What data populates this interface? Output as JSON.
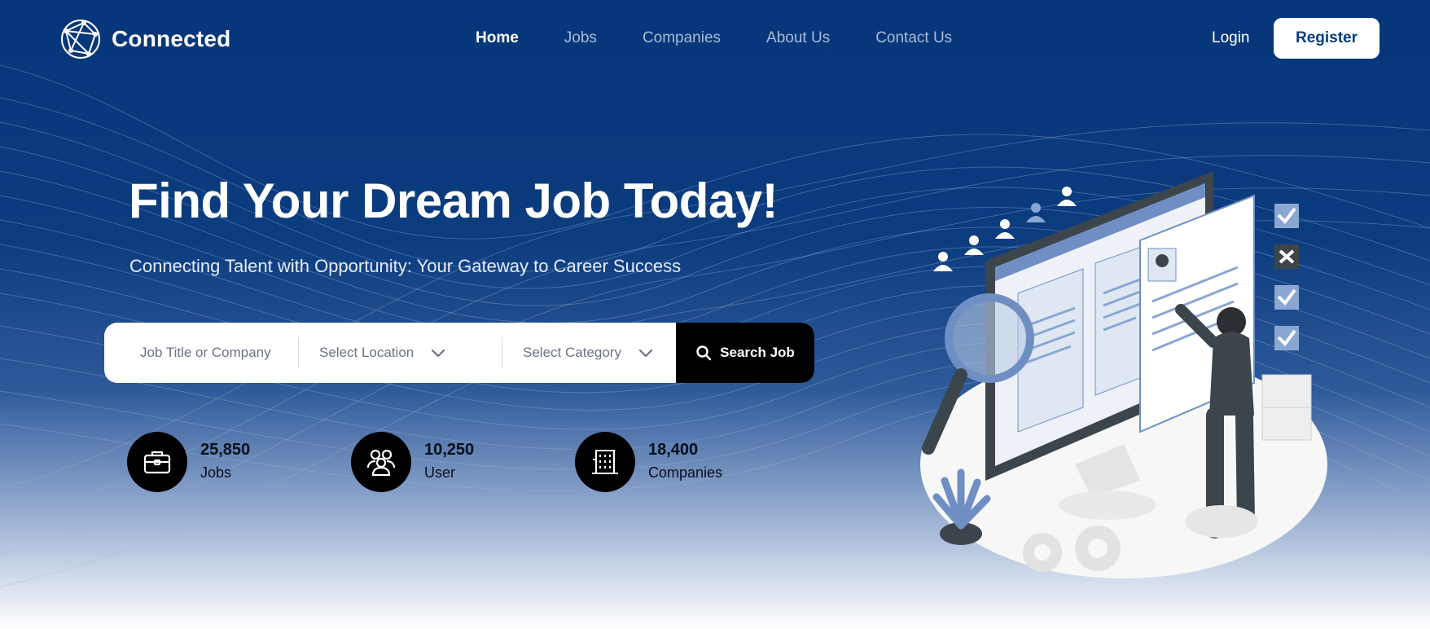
{
  "brand": {
    "name": "Connected"
  },
  "nav": {
    "items": [
      {
        "label": "Home",
        "active": true
      },
      {
        "label": "Jobs",
        "active": false
      },
      {
        "label": "Companies",
        "active": false
      },
      {
        "label": "About Us",
        "active": false
      },
      {
        "label": "Contact Us",
        "active": false
      }
    ],
    "login_label": "Login",
    "register_label": "Register"
  },
  "hero": {
    "title": "Find Your Dream Job Today!",
    "subtitle": "Connecting Talent with Opportunity: Your Gateway to Career Success"
  },
  "search": {
    "keyword_placeholder": "Job Title or Company",
    "location_placeholder": "Select Location",
    "category_placeholder": "Select Category",
    "button_label": "Search Job"
  },
  "stats": [
    {
      "value": "25,850",
      "label": "Jobs",
      "icon": "briefcase-icon"
    },
    {
      "value": "10,250",
      "label": "User",
      "icon": "users-icon"
    },
    {
      "value": "18,400",
      "label": "Companies",
      "icon": "building-icon"
    }
  ],
  "colors": {
    "primary": "#06367a",
    "accent_button": "#000000",
    "register_text": "#0b3c7e",
    "illustration_blue": "#6f8fc4"
  }
}
